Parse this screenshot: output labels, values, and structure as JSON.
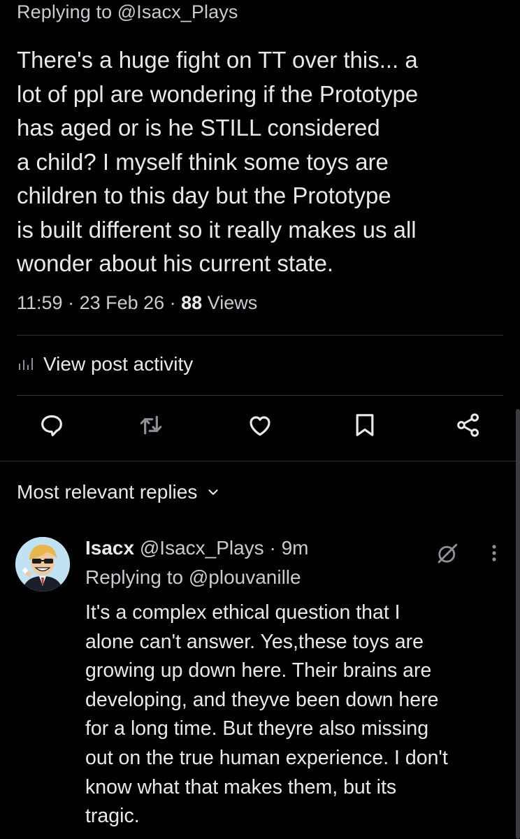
{
  "post": {
    "replying_to": "Replying to @Isacx_Plays",
    "text": "There's a huge fight on TT over this... a\nlot of ppl are wondering if the Prototype\nhas aged or is he STILL considered\na child? I myself think some toys are\nchildren to this day but the Prototype\nis built different so it really makes us all\nwonder about his current state.",
    "time": "11:59",
    "date": "23 Feb 26",
    "views_count": "88",
    "views_label": "Views",
    "separator": " · "
  },
  "activity": {
    "label": "View post activity",
    "icon": "bar-chart-icon"
  },
  "actions": [
    {
      "name": "reply",
      "icon": "comment-icon"
    },
    {
      "name": "repost",
      "icon": "repost-icon"
    },
    {
      "name": "like",
      "icon": "heart-icon"
    },
    {
      "name": "bookmark",
      "icon": "bookmark-icon"
    },
    {
      "name": "share",
      "icon": "share-icon"
    }
  ],
  "replies_sort": {
    "label": "Most relevant replies",
    "icon": "chevron-down-icon"
  },
  "reply": {
    "display_name": "Isacx",
    "handle": "@Isacx_Plays",
    "separator": " · ",
    "time_ago": "9m",
    "replying_to": "Replying to @plouvanille",
    "text": "It's a complex ethical question that I\nalone can't answer. Yes,these toys are\ngrowing up down here. Their brains are\ndeveloping, and theyve been down here\nfor a long time. But theyre also missing\nout on the true human experience. I don't\nknow what that makes them, but its\ntragic.",
    "avatar_icon": "avatar",
    "grok_icon": "grok-icon",
    "more_icon": "more-vertical-icon"
  },
  "colors": {
    "background": "#000000",
    "text_primary": "#e7e9ea",
    "text_secondary": "#c8cbcf",
    "divider": "#2f3336"
  }
}
